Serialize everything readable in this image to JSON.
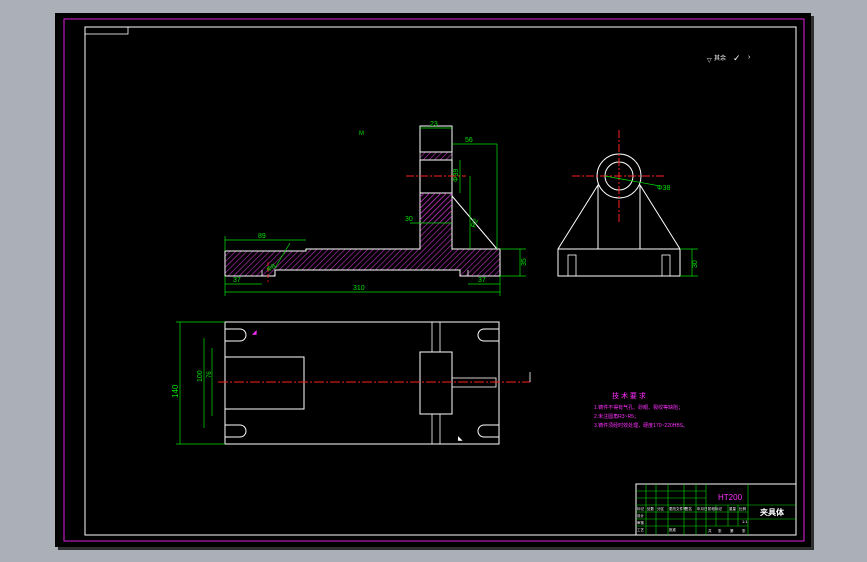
{
  "colors": {
    "frame_bg": "#aaafb8",
    "paper": "#000000",
    "border_magenta": "#e020e0",
    "line_white": "#ffffff",
    "dim_green": "#00e000",
    "hatch_magenta": "#c030c0",
    "center_red": "#ff2020",
    "annot_magenta": "#ff30ff",
    "sheet_shadow": "#303030"
  },
  "front_view": {
    "dims": [
      "23",
      "56",
      "Φ39",
      "30",
      "R2",
      "89",
      "Φ8",
      "310",
      "37",
      "37",
      "35"
    ]
  },
  "side_view": {
    "dims": [
      "Φ38",
      "30"
    ]
  },
  "top_view": {
    "dims": [
      "140",
      "100",
      "76"
    ]
  },
  "roughness": {
    "symbol_text": "其余",
    "check_mark": "✓"
  },
  "tech_requirements": {
    "title": "技 术 要 求",
    "lines": [
      "1.铸件不得有气孔、砂眼、裂纹等缺陷；",
      "2.未注圆角R3~R5；",
      "3.铸件须经时效处理，硬度170~220HBS。"
    ]
  },
  "title_block": {
    "material": "HT200",
    "part_name": "夹具体",
    "scale": "1:1",
    "labels": [
      "标记",
      "处数",
      "分区",
      "更改文件号",
      "签名",
      "年月日",
      "设计",
      "审核",
      "工艺",
      "批准",
      "阶段标记",
      "重量",
      "比例",
      "共",
      "张",
      "第",
      "张"
    ]
  }
}
